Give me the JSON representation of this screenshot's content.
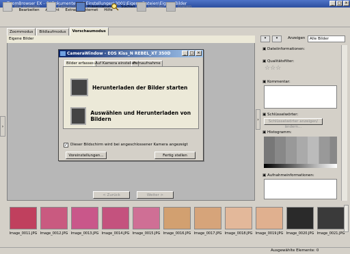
{
  "window": {
    "title": "ZoomBrowser EX - C:\\Dokumente und Einstellungen\\3001\\Eigene Dateien\\Eigene Bilder",
    "min": "_",
    "max": "□",
    "close": "×"
  },
  "menu": [
    "Datei",
    "Bearbeiten",
    "Ansicht",
    "Extras",
    "Internet",
    "Hilfe"
  ],
  "toolbar": {
    "bild_anzeigen": "Bild anzeigen",
    "eigenschaften": "Eigenschaften",
    "praesentation": "Präsentation",
    "suchen": "Suchen",
    "loeschen": "Löschen",
    "drehen": "Drehen"
  },
  "tabs": [
    "Zoommodus",
    "Bildlaufmodus",
    "Vorschaumodus"
  ],
  "path_label": "Eigene Bilder",
  "view": {
    "anzeigen_label": "Anzeigen",
    "anzeigen_value": "Alle Bilder"
  },
  "right_panel": {
    "dateiinformationen": "Dateiinformationen:",
    "qualitaetsfilter": "Qualitätsfilter:",
    "stars": "☆☆☆",
    "kommentar": "Kommentar:",
    "schluesselwoerter": "Schlüsselwörter:",
    "schluessel_button": "Schlüsselwörter anzeigen/ändern...",
    "histogramm": "Histogramm:",
    "aufnahme": "Aufnahmeinformationen:"
  },
  "dialog": {
    "title": "CameraWindow - EOS Kiss_N REBEL_XT 350D",
    "tabs": [
      "Bilder erfassen",
      "Auf Kamera einstellen",
      "Fernaufnahme"
    ],
    "action1": "Herunterladen der Bilder starten",
    "action2": "Auswählen und Herunterladen von Bildern",
    "checkbox": "Dieser Bildschirm wird bei angeschlossener Kamera angezeigt",
    "settings_button": "Voreinstellungen...",
    "done_button": "Fertig stellen"
  },
  "nav": {
    "back": "< Zurück",
    "next": "Weiter >"
  },
  "thumbnails": [
    {
      "label": "Image_0011.JPG",
      "color": "#c0405e"
    },
    {
      "label": "Image_0012.JPG",
      "color": "#c95a80"
    },
    {
      "label": "Image_0013.JPG",
      "color": "#c9578a"
    },
    {
      "label": "Image_0014.JPG",
      "color": "#c4527e"
    },
    {
      "label": "Image_0015.JPG",
      "color": "#cf6f95"
    },
    {
      "label": "Image_0016.JPG",
      "color": "#d2a070"
    },
    {
      "label": "Image_0017.JPG",
      "color": "#d6a47a"
    },
    {
      "label": "Image_0018.JPG",
      "color": "#e3b89a"
    },
    {
      "label": "Image_0019.JPG",
      "color": "#e0b08f"
    },
    {
      "label": "Image_0020.JPG",
      "color": "#2a2a2a"
    },
    {
      "label": "Image_0021.JPG",
      "color": "#3a3a3a"
    }
  ],
  "status": {
    "selected": "Ausgewählte Elemente: 0"
  }
}
